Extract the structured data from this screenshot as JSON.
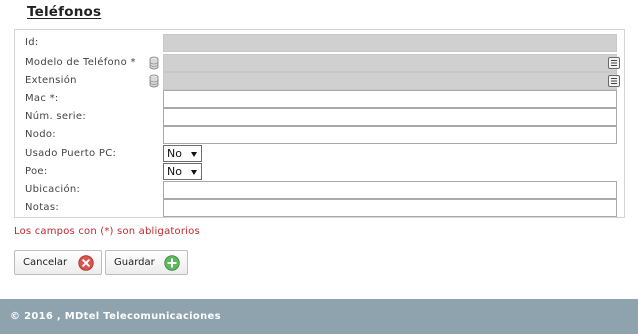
{
  "page": {
    "title": "Teléfonos"
  },
  "form": {
    "fields": [
      {
        "label": "Id:",
        "value": ""
      },
      {
        "label": "Modelo de Teléfono *",
        "value": ""
      },
      {
        "label": "Extensión",
        "value": ""
      },
      {
        "label": "Mac *:",
        "value": ""
      },
      {
        "label": "Núm. serie:",
        "value": ""
      },
      {
        "label": "Nodo:",
        "value": ""
      },
      {
        "label": "Usado Puerto PC:",
        "value": "No"
      },
      {
        "label": "Poe:",
        "value": "No"
      },
      {
        "label": "Ubicación:",
        "value": ""
      },
      {
        "label": "Notas:",
        "value": ""
      }
    ],
    "required_note": "Los campos con (*) son abligatorios"
  },
  "buttons": {
    "cancel_label": "Cancelar",
    "save_label": "Guardar"
  },
  "footer": {
    "text": "© 2016 , MDtel Telecomunicaciones"
  },
  "icons": {
    "database": "database-icon",
    "list": "list-icon",
    "cancel": "red-x-circle-icon",
    "save": "green-plus-circle-icon"
  },
  "colors": {
    "required_note": "#c1272d",
    "footer_bg": "#8ea3ae",
    "readonly_bg": "#d0d0d0",
    "cancel_icon": "#d9534f",
    "save_icon": "#4cae4c"
  }
}
